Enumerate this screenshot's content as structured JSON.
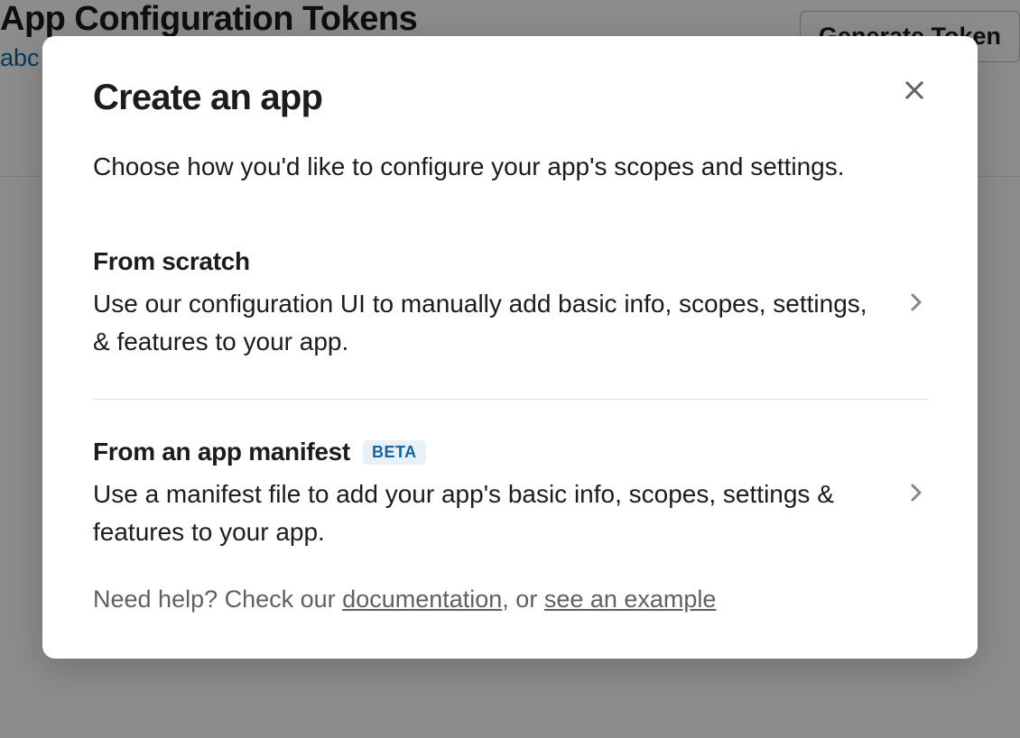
{
  "background": {
    "title": "App Configuration Tokens",
    "link_text": "abc",
    "button_label": "Generate Token"
  },
  "modal": {
    "title": "Create an app",
    "subtitle": "Choose how you'd like to configure your app's scopes and settings.",
    "options": [
      {
        "title": "From scratch",
        "description": "Use our configuration UI to manually add basic info, scopes, settings, & features to your app.",
        "badge": null
      },
      {
        "title": "From an app manifest",
        "description": "Use a manifest file to add your app's basic info, scopes, settings & features to your app.",
        "badge": "BETA"
      }
    ],
    "help": {
      "prefix": "Need help? Check our ",
      "doc_link": "documentation",
      "middle": ", or ",
      "example_link": "see an example"
    }
  }
}
